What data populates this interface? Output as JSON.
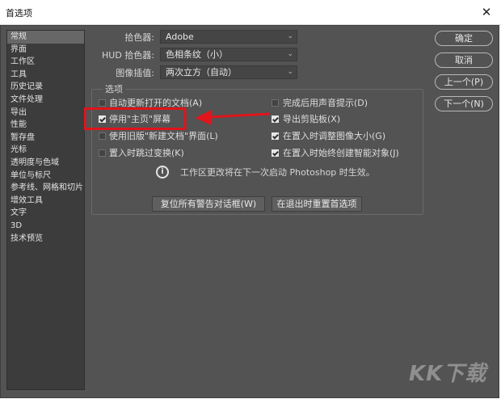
{
  "window": {
    "title": "首选项"
  },
  "sidebar": {
    "items": [
      {
        "label": "常规",
        "selected": true
      },
      {
        "label": "界面"
      },
      {
        "label": "工作区"
      },
      {
        "label": "工具"
      },
      {
        "label": "历史记录"
      },
      {
        "label": "文件处理"
      },
      {
        "label": "导出"
      },
      {
        "label": "性能"
      },
      {
        "label": "暂存盘"
      },
      {
        "label": "光标"
      },
      {
        "label": "透明度与色域"
      },
      {
        "label": "单位与标尺"
      },
      {
        "label": "参考线、网格和切片"
      },
      {
        "label": "增效工具"
      },
      {
        "label": "文字"
      },
      {
        "label": "3D"
      },
      {
        "label": "技术预览"
      }
    ]
  },
  "form": {
    "color_picker": {
      "label": "拾色器:",
      "value": "Adobe"
    },
    "hud_picker": {
      "label": "HUD 拾色器:",
      "value": "色相条纹（小）"
    },
    "interpolation": {
      "label": "图像插值:",
      "value": "两次立方（自动）"
    }
  },
  "options": {
    "title": "选项",
    "items": [
      {
        "label": "自动更新打开的文档(A)",
        "checked": false
      },
      {
        "label": "停用\"主页\"屏幕",
        "checked": true
      },
      {
        "label": "使用旧版\"新建文档\"界面(L)",
        "checked": false
      },
      {
        "label": "置入时跳过变换(K)",
        "checked": false
      },
      {
        "label": "完成后用声音提示(D)",
        "checked": false
      },
      {
        "label": "导出剪贴板(X)",
        "checked": true
      },
      {
        "label": "在置入时调整图像大小(G)",
        "checked": true
      },
      {
        "label": "在置入时始终创建智能对象(J)",
        "checked": true
      }
    ],
    "info": "工作区更改将在下一次启动 Photoshop 时生效。"
  },
  "buttons": {
    "reset_warnings": "复位所有警告对话框(W)",
    "reset_on_quit": "在退出时重置首选项",
    "ok": "确定",
    "cancel": "取消",
    "prev": "上一个(P)",
    "next": "下一个(N)"
  },
  "watermark": "KK下载",
  "colors": {
    "highlight": "#e0141b",
    "dialog_bg": "#535353",
    "sidebar_bg": "#3c3c3c"
  }
}
